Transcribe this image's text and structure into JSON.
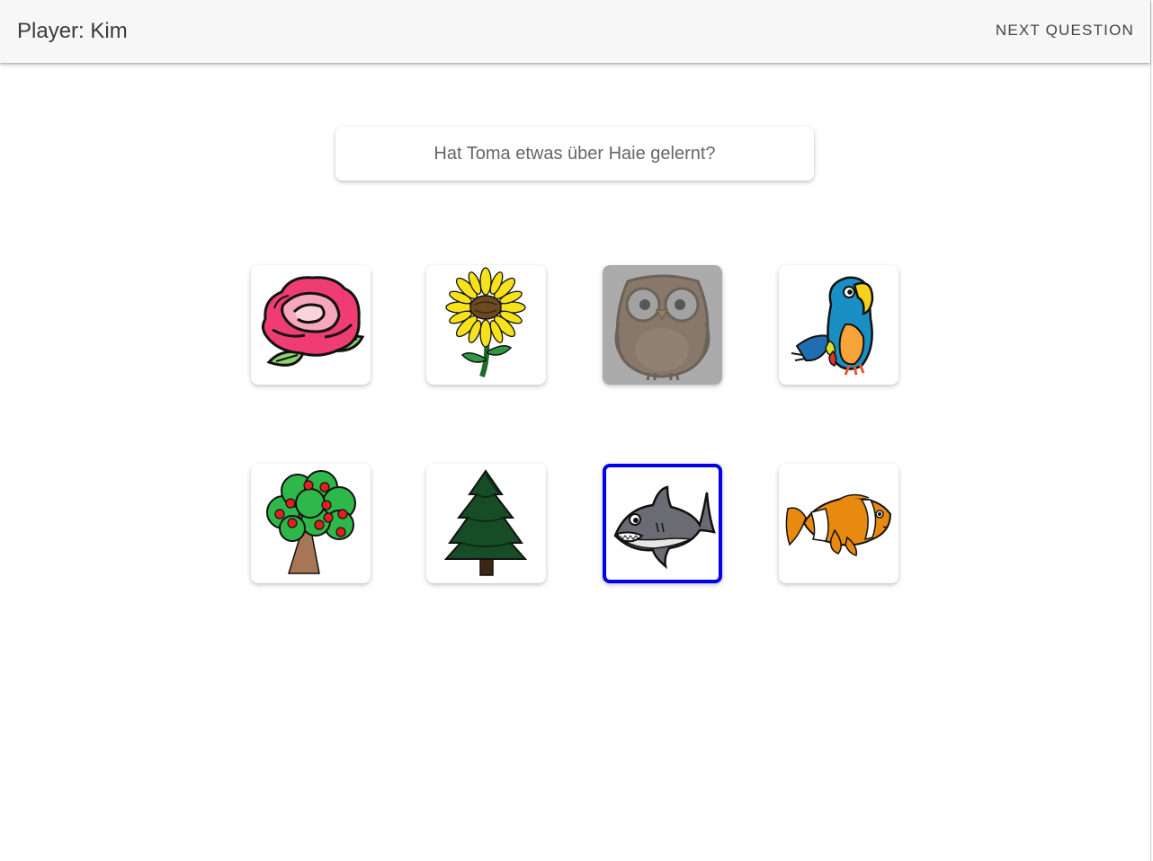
{
  "header": {
    "player_title": "Player: Kim",
    "next_question_label": "NEXT QUESTION"
  },
  "question": {
    "text": "Hat Toma etwas über Haie gelernt?"
  },
  "tiles": [
    {
      "icon": "rose-icon",
      "state": "normal"
    },
    {
      "icon": "sunflower-icon",
      "state": "normal"
    },
    {
      "icon": "owl-icon",
      "state": "disabled"
    },
    {
      "icon": "parrot-icon",
      "state": "normal"
    },
    {
      "icon": "apple-tree-icon",
      "state": "normal"
    },
    {
      "icon": "fir-tree-icon",
      "state": "normal"
    },
    {
      "icon": "shark-icon",
      "state": "selected"
    },
    {
      "icon": "clownfish-icon",
      "state": "normal"
    }
  ],
  "colors": {
    "appbar_background": "#f7f7f7",
    "selected_border": "#0000ee",
    "disabled_overlay": "#787878"
  }
}
